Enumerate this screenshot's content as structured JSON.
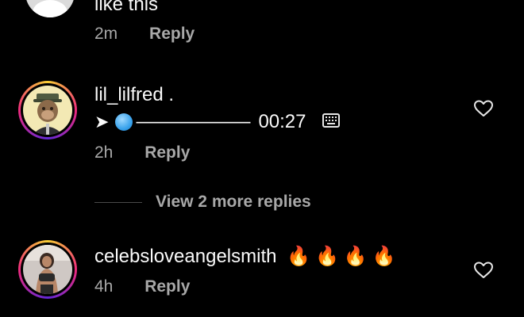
{
  "comments": [
    {
      "body": "like this",
      "time": "2m",
      "reply_label": "Reply"
    },
    {
      "username": "lil_lilfred .",
      "voice": {
        "arrow": "➤",
        "dashes": "——————",
        "duration": "00:27"
      },
      "time": "2h",
      "reply_label": "Reply"
    },
    {
      "username": "celebsloveangelsmith",
      "emoji": [
        "🔥",
        "🔥",
        "🔥",
        "🔥"
      ],
      "time": "4h",
      "reply_label": "Reply"
    }
  ],
  "view_more": "View 2 more replies",
  "colors": {
    "background": "#000000",
    "text": "#fafafa",
    "secondary": "#a8a8a8"
  },
  "icons": [
    "heart-outline-icon",
    "keyboard-icon",
    "play-arrow-icon"
  ]
}
